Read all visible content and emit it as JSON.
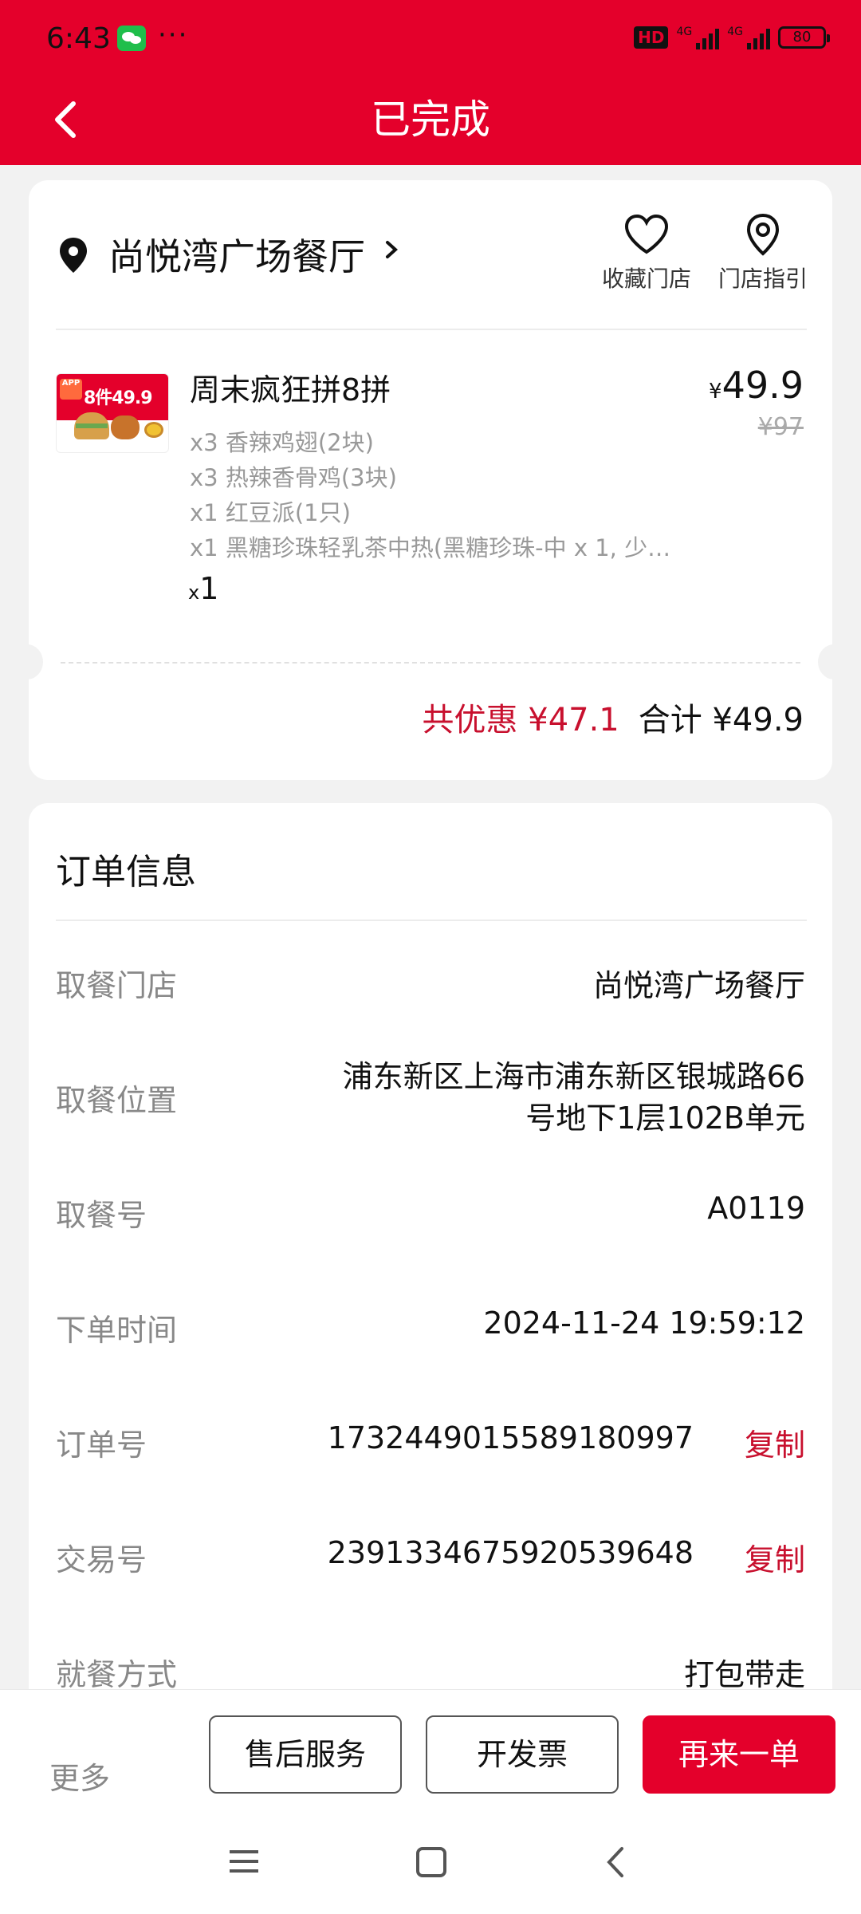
{
  "status_bar": {
    "time": "6:43",
    "more": "···",
    "hd": "HD",
    "net1": "4G",
    "net2": "4G",
    "battery": "80"
  },
  "header": {
    "title": "已完成"
  },
  "store": {
    "name": "尚悦湾广场餐厅",
    "favorite_label": "收藏门店",
    "guide_label": "门店指引"
  },
  "product": {
    "image_text": "8件49.9",
    "image_badge": "APP",
    "name": "周末疯狂拼8拼",
    "price_symbol": "¥",
    "price": "49.9",
    "original_price": "¥97",
    "items": [
      "x3 香辣鸡翅(2块)",
      "x3 热辣香骨鸡(3块)",
      "x1 红豆派(1只)",
      "x1 黑糖珍珠轻乳茶中热(黑糖珍珠-中 x 1, 少…"
    ],
    "qty_prefix": "x",
    "qty": "1"
  },
  "summary": {
    "discount": "共优惠 ¥47.1",
    "total": "合计 ¥49.9"
  },
  "order_info": {
    "title": "订单信息",
    "rows": [
      {
        "label": "取餐门店",
        "value": "尚悦湾广场餐厅"
      },
      {
        "label": "取餐位置",
        "value_line1": "浦东新区上海市浦东新区银城路66",
        "value_line2": "号地下1层102B单元"
      },
      {
        "label": "取餐号",
        "value": "A0119"
      },
      {
        "label": "下单时间",
        "value": "2024-11-24 19:59:12"
      },
      {
        "label": "订单号",
        "value": "1732449015589180997",
        "action": "复制"
      },
      {
        "label": "交易号",
        "value": "2391334675920539648",
        "action": "复制"
      },
      {
        "label": "就餐方式",
        "value": "打包带走"
      }
    ]
  },
  "bottom_bar": {
    "more": "更多",
    "after_sale": "售后服务",
    "invoice": "开发票",
    "reorder": "再来一单"
  },
  "colors": {
    "brand_red": "#e4002b",
    "discount_red": "#c8102e",
    "background": "#f2f2f2"
  }
}
